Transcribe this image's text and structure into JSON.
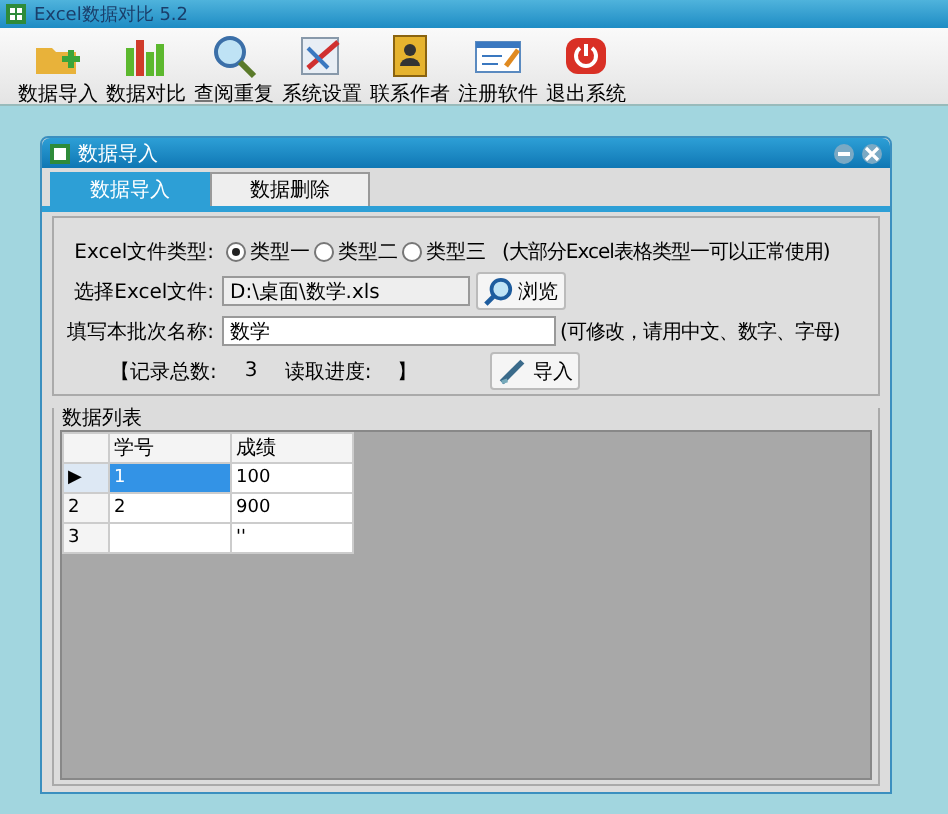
{
  "window": {
    "title": "Excel数据对比 5.2"
  },
  "toolbar": [
    {
      "label": "数据导入"
    },
    {
      "label": "数据对比"
    },
    {
      "label": "查阅重复"
    },
    {
      "label": "系统设置"
    },
    {
      "label": "联系作者"
    },
    {
      "label": "注册软件"
    },
    {
      "label": "退出系统"
    }
  ],
  "dialog": {
    "title": "数据导入",
    "tabs": [
      {
        "label": "数据导入",
        "selected": true
      },
      {
        "label": "数据删除",
        "selected": false
      }
    ],
    "file_type": {
      "label": "Excel文件类型:",
      "options": [
        {
          "label": "类型一",
          "selected": true
        },
        {
          "label": "类型二",
          "selected": false
        },
        {
          "label": "类型三",
          "selected": false
        }
      ],
      "hint": "(大部分Excel表格类型一可以正常使用)"
    },
    "file": {
      "label": "选择Excel文件:",
      "value": "D:\\桌面\\数学.xls",
      "button": "浏览"
    },
    "batch_name": {
      "label": "填写本批次名称:",
      "value": "数学",
      "hint": "(可修改，请用中文、数字、字母)"
    },
    "status": {
      "open": "【",
      "count_label": "记录总数:",
      "count": "3",
      "progress_label": "读取进度:",
      "close": "】",
      "button": "导入"
    },
    "data_list": {
      "title": "数据列表",
      "columns": [
        "学号",
        "成绩"
      ],
      "rows": [
        {
          "marker": "▶",
          "selected": true,
          "cells": [
            "1",
            "100"
          ]
        },
        {
          "marker": "2",
          "selected": false,
          "cells": [
            "2",
            "900"
          ]
        },
        {
          "marker": "3",
          "selected": false,
          "cells": [
            null,
            "''"
          ]
        }
      ]
    }
  }
}
